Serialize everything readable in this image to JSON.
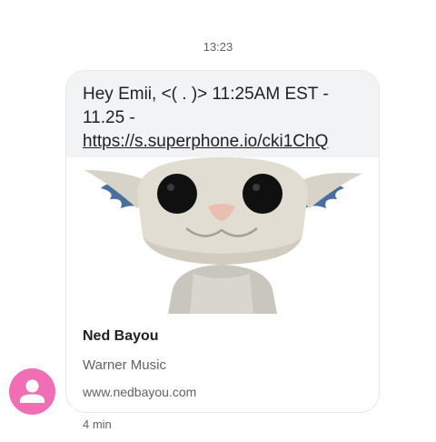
{
  "conversation": {
    "timestamp": "13:23",
    "message": {
      "text_prefix": "Hey Emii, <( . )> 11:25AM EST - 11.25 - ",
      "link_text": "https://s.superphone.io/cki1ChQ",
      "age": "4 min"
    },
    "link_preview": {
      "image_icon": "vinyl-toy-figure-image",
      "title": "Ned Bayou",
      "subtitle": "Warner Music",
      "domain": "www.nedbayou.com"
    },
    "sender": {
      "avatar_icon": "person-icon",
      "avatar_color": "#f06eb3"
    }
  },
  "colors": {
    "bubble_background": "#f1f3f4",
    "text_primary": "#202124",
    "text_secondary": "#5f6368"
  }
}
